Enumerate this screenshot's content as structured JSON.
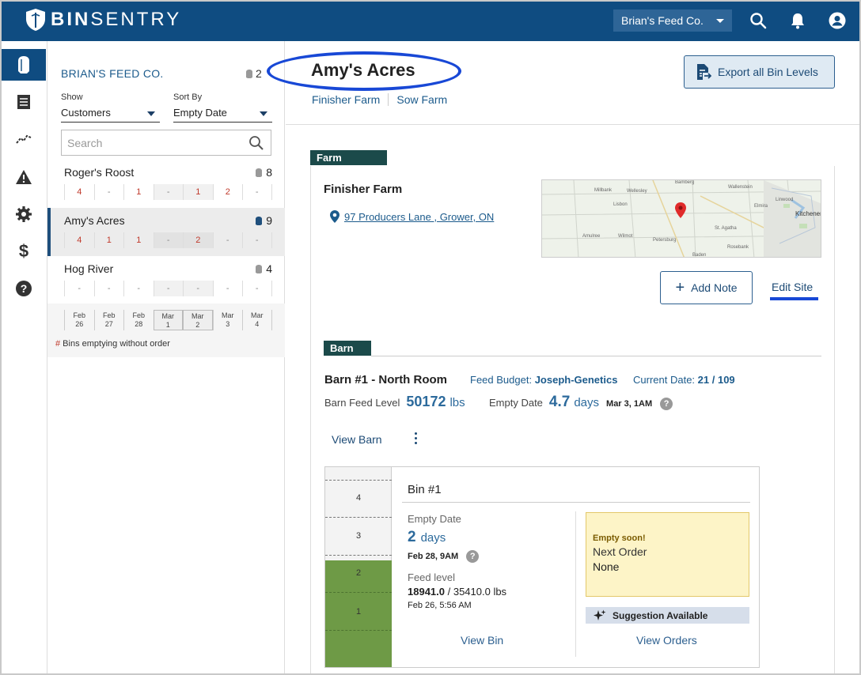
{
  "app": {
    "brand_bold": "BIN",
    "brand_rest": "SENTRY",
    "account_selector": "Brian's Feed Co."
  },
  "sidebar": {
    "company": "BRIAN'S FEED CO.",
    "company_count": "2",
    "show_label": "Show",
    "show_value": "Customers",
    "sort_label": "Sort By",
    "sort_value": "Empty Date",
    "search_placeholder": "Search",
    "customers": [
      {
        "name": "Roger's Roost",
        "count": "8",
        "cells": [
          "4",
          "-",
          "1",
          "-",
          "1",
          "2",
          "-"
        ]
      },
      {
        "name": "Amy's Acres",
        "count": "9",
        "cells": [
          "4",
          "1",
          "1",
          "-",
          "2",
          "-",
          "-"
        ]
      },
      {
        "name": "Hog River",
        "count": "4",
        "cells": [
          "-",
          "-",
          "-",
          "-",
          "-",
          "-",
          "-"
        ]
      }
    ],
    "dates": [
      {
        "m": "Feb",
        "d": "26"
      },
      {
        "m": "Feb",
        "d": "27"
      },
      {
        "m": "Feb",
        "d": "28"
      },
      {
        "m": "Mar",
        "d": "1"
      },
      {
        "m": "Mar",
        "d": "2"
      },
      {
        "m": "Mar",
        "d": "3"
      },
      {
        "m": "Mar",
        "d": "4"
      }
    ],
    "legend_hash": "#",
    "legend_text": " Bins emptying without order"
  },
  "header": {
    "title": "Amy's Acres",
    "crumbs": [
      "Finisher Farm",
      "Sow Farm"
    ],
    "export_label": "Export all Bin Levels"
  },
  "farm": {
    "tag": "Farm",
    "name": "Finisher Farm",
    "address": "97 Producers Lane , Grower, ON",
    "map_labels": [
      "Millbank",
      "Wellesley",
      "Bamberg",
      "Linwood",
      "Wallenstein",
      "Elmira",
      "Kitchener",
      "Lisbon",
      "St. Agatha",
      "Amulree",
      "Baden",
      "Petersburg",
      "Wilmot",
      "Rosebank"
    ],
    "add_note_label": "Add Note",
    "edit_site_label": "Edit Site"
  },
  "barn": {
    "tag": "Barn",
    "title": "Barn #1 - North Room",
    "budget_label": "Feed Budget:",
    "budget_value": "Joseph-Genetics",
    "current_label": "Current Date:",
    "current_value": "21 / 109",
    "level_label": "Barn Feed Level",
    "level_value": "50172",
    "level_unit": "lbs",
    "empty_label": "Empty Date",
    "empty_value": "4.7",
    "empty_unit": "days",
    "empty_when": "Mar 3, 1AM",
    "view_barn_label": "View Barn"
  },
  "bin": {
    "name": "Bin #1",
    "gauge_levels": [
      "4",
      "3",
      "2",
      "1"
    ],
    "fill_fraction": 0.535,
    "empty_label": "Empty Date",
    "empty_value": "2",
    "empty_unit": "days",
    "empty_when": "Feb 28, 9AM",
    "feed_label": "Feed level",
    "feed_current": "18941.0",
    "feed_total": " / 35410.0 lbs",
    "feed_time": "Feb 26, 5:56 AM",
    "alert_title": "Empty soon!",
    "alert_next": "Next Order",
    "alert_value": "None",
    "suggest_label": "Suggestion Available",
    "view_bin_label": "View Bin",
    "view_orders_label": "View Orders"
  },
  "colors": {
    "brand": "#0f4c81",
    "highlight": "#1848d6",
    "gauge_fill": "#6e9a46"
  }
}
